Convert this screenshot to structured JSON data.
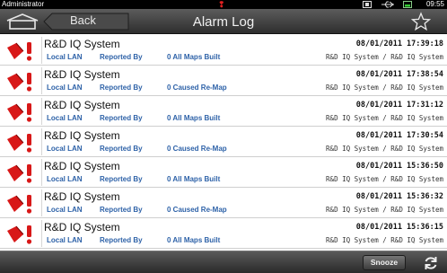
{
  "statusbar": {
    "user": "Administrator",
    "alert_glyph": "❢",
    "time": "09:55",
    "icons": [
      "notification-icon",
      "usb-icon",
      "battery-icon"
    ]
  },
  "header": {
    "back_label": "Back",
    "title": "Alarm Log",
    "icons": {
      "home": "home-icon",
      "favorite": "star-icon"
    }
  },
  "alarms": [
    {
      "system": "R&D IQ System",
      "location": "Local LAN",
      "reported_by_label": "Reported By",
      "status": "0 All Maps Built",
      "timestamp": "08/01/2011 17:39:18",
      "path": "R&D IQ System / R&D IQ System"
    },
    {
      "system": "R&D IQ System",
      "location": "Local LAN",
      "reported_by_label": "Reported By",
      "status": "0 Caused Re-Map",
      "timestamp": "08/01/2011 17:38:54",
      "path": "R&D IQ System / R&D IQ System"
    },
    {
      "system": "R&D IQ System",
      "location": "Local LAN",
      "reported_by_label": "Reported By",
      "status": "0 All Maps Built",
      "timestamp": "08/01/2011 17:31:12",
      "path": "R&D IQ System / R&D IQ System"
    },
    {
      "system": "R&D IQ System",
      "location": "Local LAN",
      "reported_by_label": "Reported By",
      "status": "0 Caused Re-Map",
      "timestamp": "08/01/2011 17:30:54",
      "path": "R&D IQ System / R&D IQ System"
    },
    {
      "system": "R&D IQ System",
      "location": "Local LAN",
      "reported_by_label": "Reported By",
      "status": "0 All Maps Built",
      "timestamp": "08/01/2011 15:36:50",
      "path": "R&D IQ System / R&D IQ System"
    },
    {
      "system": "R&D IQ System",
      "location": "Local LAN",
      "reported_by_label": "Reported By",
      "status": "0 Caused Re-Map",
      "timestamp": "08/01/2011 15:36:32",
      "path": "R&D IQ System / R&D IQ System"
    },
    {
      "system": "R&D IQ System",
      "location": "Local LAN",
      "reported_by_label": "Reported By",
      "status": "0 All Maps Built",
      "timestamp": "08/01/2011 15:36:15",
      "path": "R&D IQ System / R&D IQ System"
    }
  ],
  "footer": {
    "snooze_label": "Snooze",
    "icons": {
      "refresh": "refresh-icon"
    }
  },
  "colors": {
    "alarm_red": "#d81818",
    "field_blue": "#2e62a8",
    "bar_dark": "#2e2e2e"
  }
}
